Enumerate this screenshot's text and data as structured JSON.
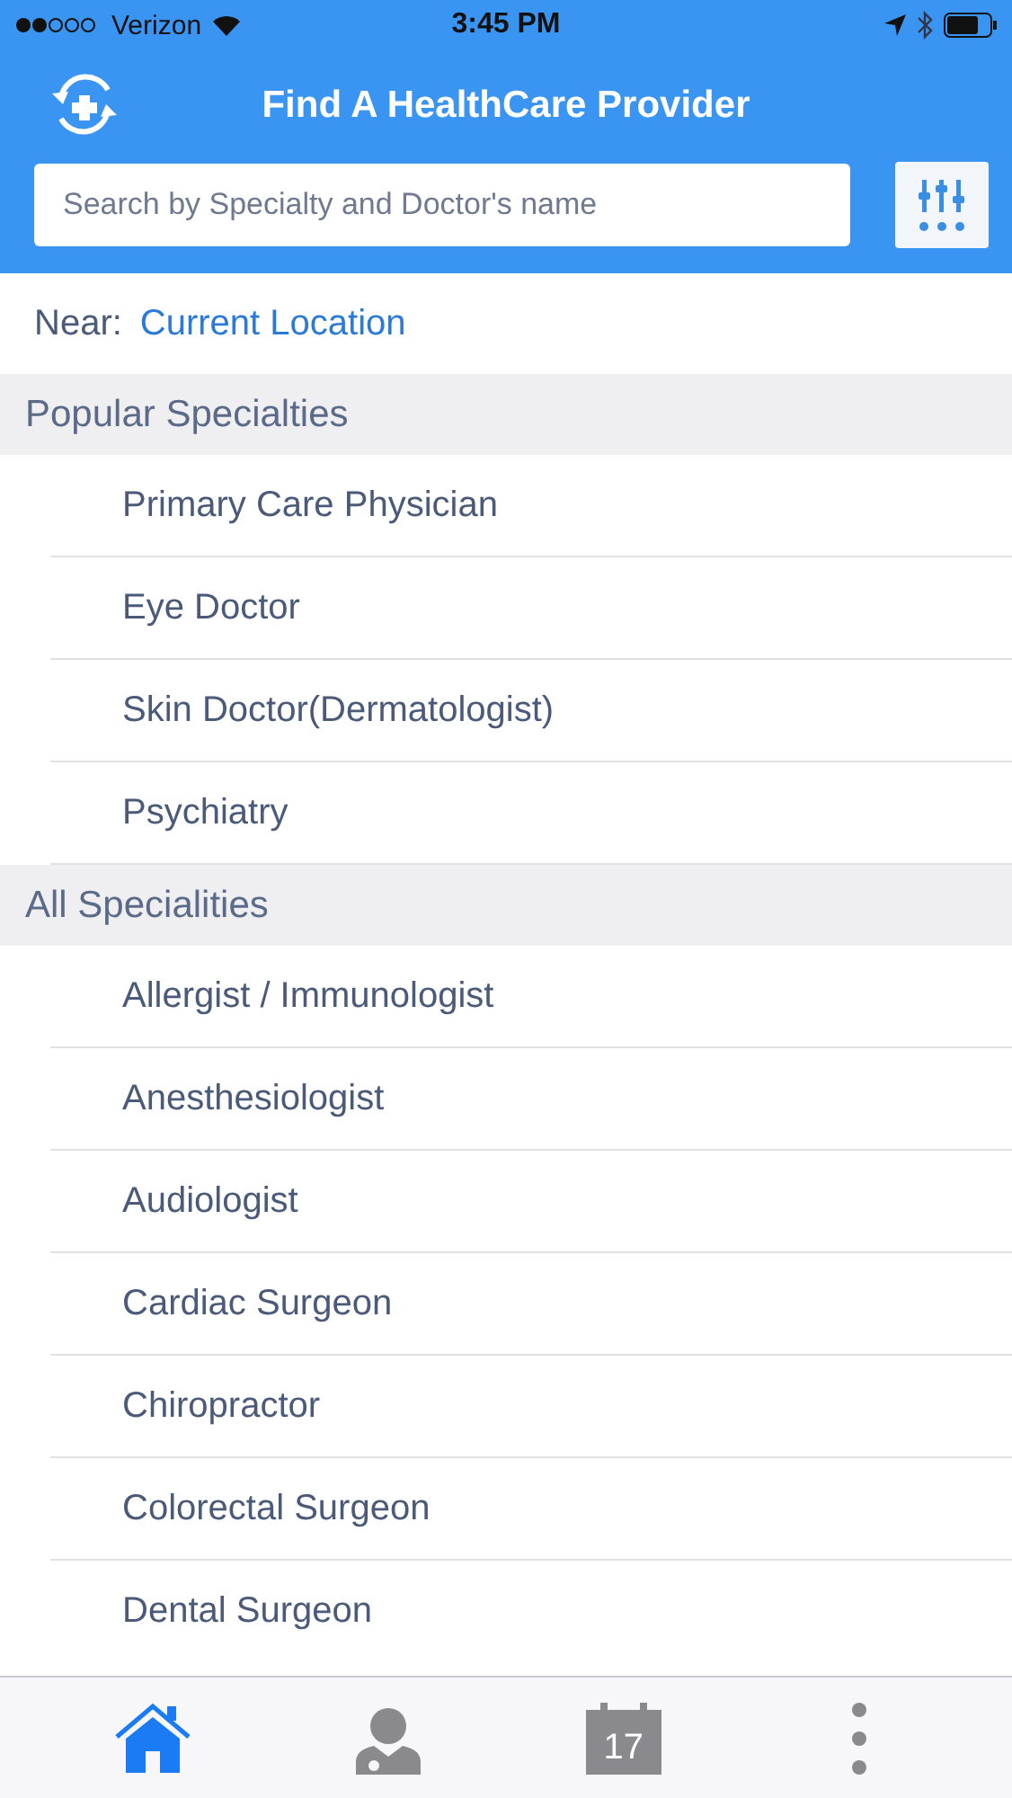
{
  "status_bar": {
    "carrier": "Verizon",
    "time": "3:45 PM"
  },
  "header": {
    "title": "Find A HealthCare Provider"
  },
  "search": {
    "placeholder": "Search by Specialty and Doctor's name"
  },
  "near": {
    "label": "Near:",
    "value": "Current Location"
  },
  "sections": [
    {
      "title": "Popular Specialties",
      "items": [
        "Primary Care Physician",
        "Eye Doctor",
        "Skin Doctor(Dermatologist)",
        "Psychiatry"
      ]
    },
    {
      "title": "All Specialities",
      "items": [
        "Allergist / Immunologist",
        "Anesthesiologist",
        "Audiologist",
        "Cardiac Surgeon",
        "Chiropractor",
        "Colorectal Surgeon",
        "Dental Surgeon"
      ]
    }
  ],
  "tabs": [
    {
      "kind": "home",
      "selected": true
    },
    {
      "kind": "doctor",
      "selected": false
    },
    {
      "kind": "calendar",
      "label": "17",
      "selected": false
    },
    {
      "kind": "more",
      "selected": false
    }
  ]
}
